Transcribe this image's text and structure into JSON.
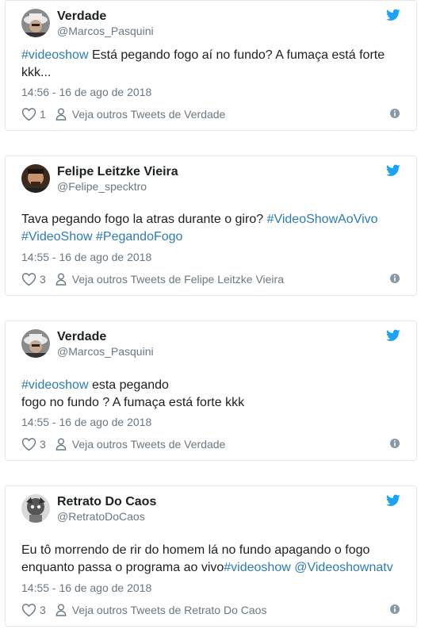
{
  "colors": {
    "link": "#2b7bb9",
    "secondary": "#697882",
    "border": "#e1e8ed",
    "twitter_blue": "#1da1f2"
  },
  "tweets": [
    {
      "name": "Verdade",
      "handle": "@Marcos_Pasquini",
      "text_parts": [
        {
          "type": "hashtag",
          "text": "#videoshow"
        },
        {
          "type": "text",
          "text": " Está pegando fogo aí no fundo? A fumaça está forte kkk..."
        }
      ],
      "time": "14:56 - 16 de ago de 2018",
      "likes": "1",
      "more_link": "Veja outros Tweets de Verdade"
    },
    {
      "name": "Felipe Leitzke Vieira",
      "handle": "@Felipe_specktro",
      "text_parts": [
        {
          "type": "text",
          "text": "Tava pegando fogo la atras durante o giro? "
        },
        {
          "type": "hashtag",
          "text": "#VideoShowAoVivo"
        },
        {
          "type": "text",
          "text": " "
        },
        {
          "type": "hashtag",
          "text": "#VideoShow"
        },
        {
          "type": "text",
          "text": " "
        },
        {
          "type": "hashtag",
          "text": "#PegandoFogo"
        }
      ],
      "time": "14:55 - 16 de ago de 2018",
      "likes": "3",
      "more_link": "Veja outros Tweets de Felipe Leitzke Vieira"
    },
    {
      "name": "Verdade",
      "handle": "@Marcos_Pasquini",
      "text_parts": [
        {
          "type": "hashtag",
          "text": "#videoshow"
        },
        {
          "type": "text",
          "text": " esta pegando"
        },
        {
          "type": "br"
        },
        {
          "type": "text",
          "text": "fogo no fundo ? A fumaça está forte kkk"
        }
      ],
      "time": "14:55 - 16 de ago de 2018",
      "likes": "3",
      "more_link": "Veja outros Tweets de Verdade"
    },
    {
      "name": "Retrato Do Caos",
      "handle": "@RetratoDoCaos",
      "text_parts": [
        {
          "type": "text",
          "text": "Eu tô morrendo de rir do homem lá no fundo apagando o fogo enquanto passa o programa ao vivo"
        },
        {
          "type": "hashtag",
          "text": "#videoshow"
        },
        {
          "type": "text",
          "text": " "
        },
        {
          "type": "hashtag",
          "text": "@Videoshownatv"
        }
      ],
      "time": "14:55 - 16 de ago de 2018",
      "likes": "3",
      "more_link": "Veja outros Tweets de Retrato Do Caos"
    }
  ]
}
